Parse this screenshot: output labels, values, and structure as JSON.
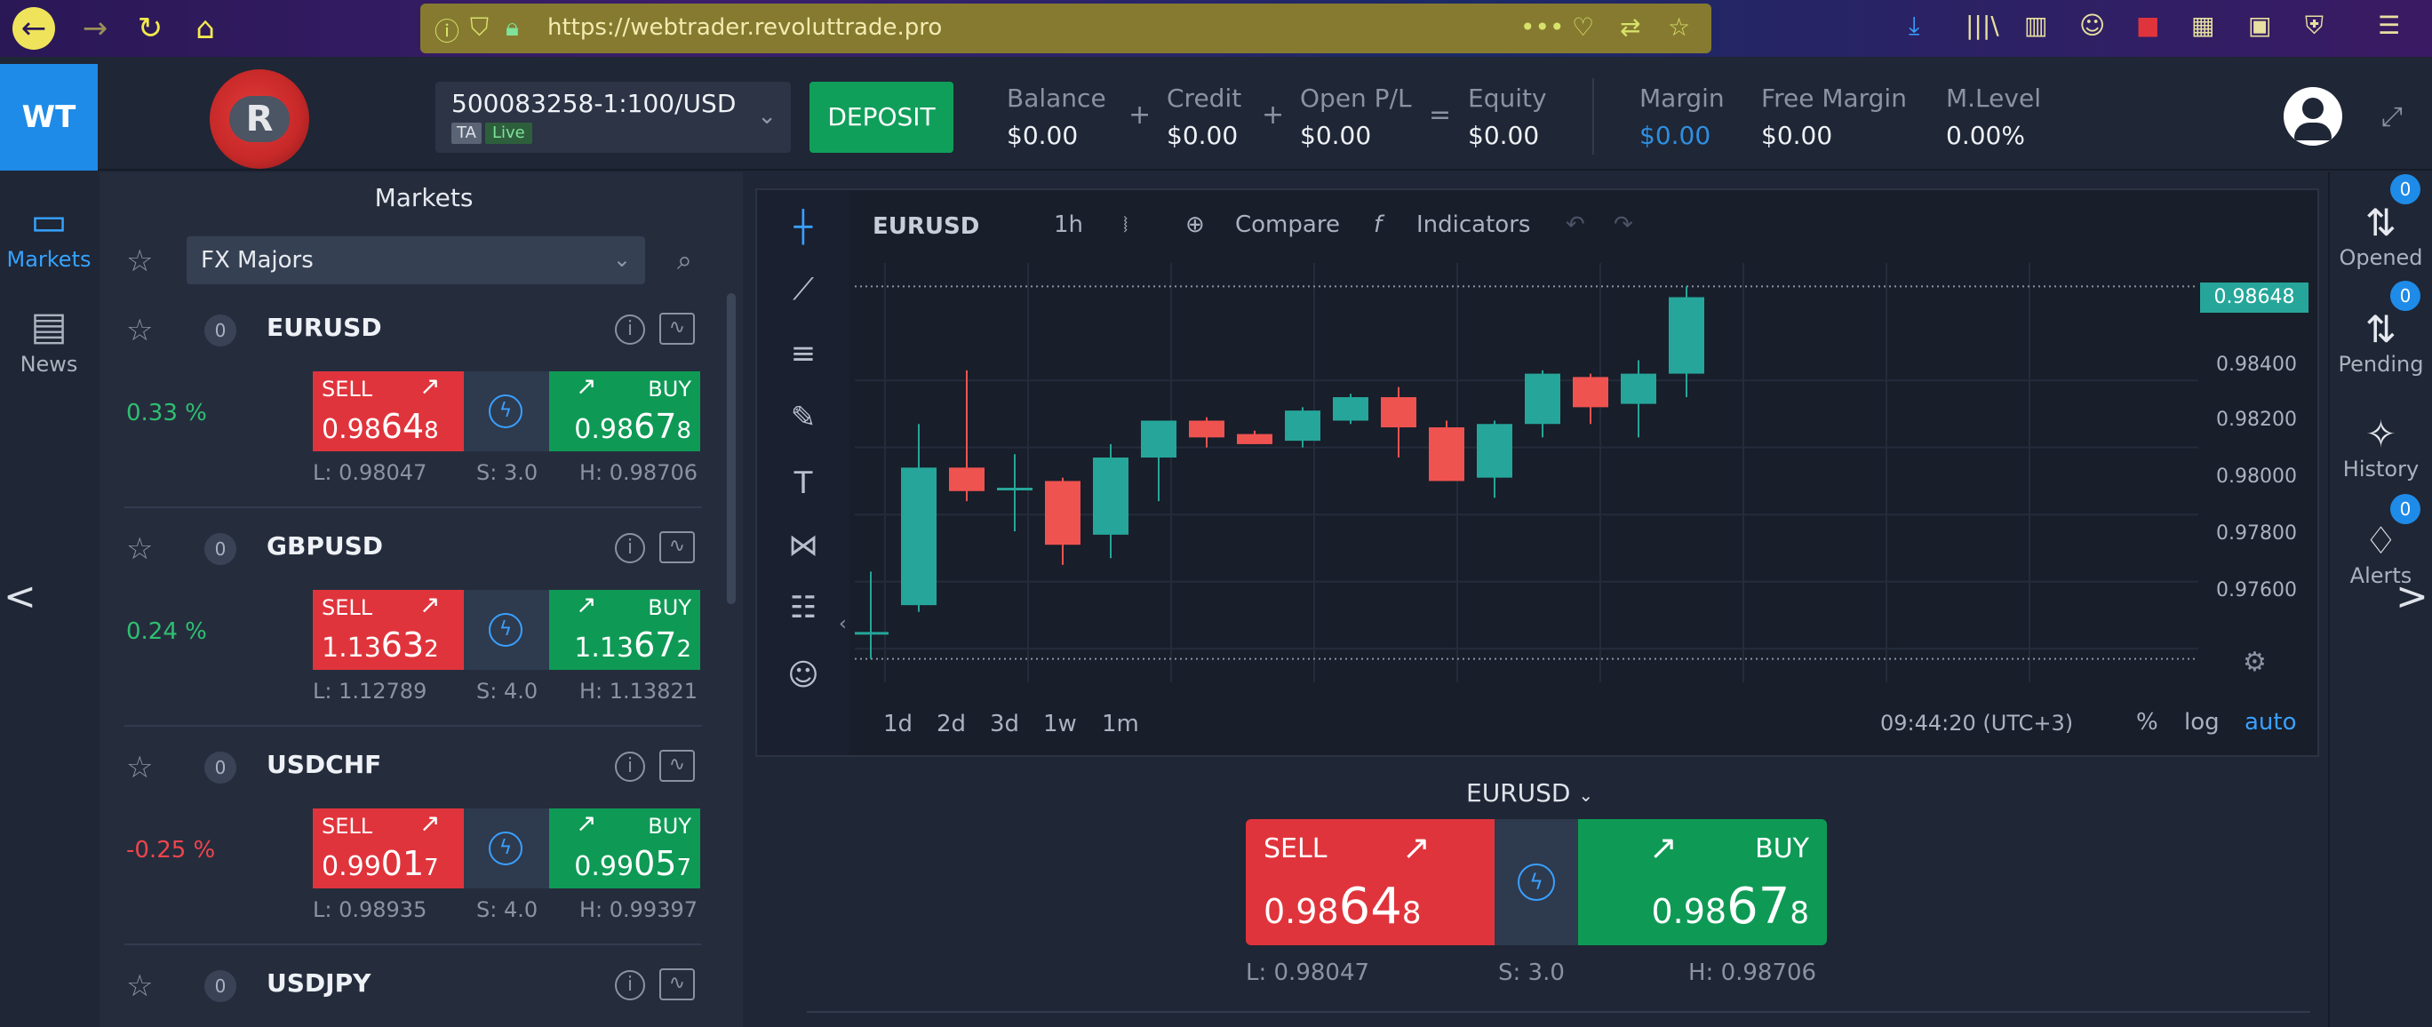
{
  "browser": {
    "url": "https://webtrader.revoluttrade.pro"
  },
  "header": {
    "logo_text": "WT",
    "brand_letter": "R",
    "account_number": "500083258-1:100/USD",
    "account_tag": "TA",
    "account_status": "Live",
    "deposit_label": "DEPOSIT",
    "stats": [
      {
        "label": "Balance",
        "value": "$0.00"
      },
      {
        "label": "Credit",
        "value": "$0.00"
      },
      {
        "label": "Open P/L",
        "value": "$0.00"
      },
      {
        "label": "Equity",
        "value": "$0.00"
      },
      {
        "label": "Margin",
        "value": "$0.00"
      },
      {
        "label": "Free Margin",
        "value": "$0.00"
      },
      {
        "label": "M.Level",
        "value": "0.00%"
      }
    ],
    "operators": [
      "+",
      "+",
      "="
    ],
    "margin_color": "#2f8fe0"
  },
  "sidebar": {
    "markets_label": "Markets",
    "news_label": "News"
  },
  "markets": {
    "title": "Markets",
    "filter": "FX Majors",
    "rows": [
      {
        "symbol": "EURUSD",
        "count": "0",
        "change": "0.33 %",
        "sell_label": "SELL",
        "buy_label": "BUY",
        "sell_price": {
          "pre": "0.98",
          "big": "64",
          "post": "8"
        },
        "buy_price": {
          "pre": "0.98",
          "big": "67",
          "post": "8"
        },
        "low": "L: 0.98047",
        "spread": "S: 3.0",
        "high": "H: 0.98706"
      },
      {
        "symbol": "GBPUSD",
        "count": "0",
        "change": "0.24 %",
        "sell_label": "SELL",
        "buy_label": "BUY",
        "sell_price": {
          "pre": "1.13",
          "big": "63",
          "post": "2"
        },
        "buy_price": {
          "pre": "1.13",
          "big": "67",
          "post": "2"
        },
        "low": "L: 1.12789",
        "spread": "S: 4.0",
        "high": "H: 1.13821"
      },
      {
        "symbol": "USDCHF",
        "count": "0",
        "change": "-0.25 %",
        "sell_label": "SELL",
        "buy_label": "BUY",
        "sell_price": {
          "pre": "0.99",
          "big": "01",
          "post": "7"
        },
        "buy_price": {
          "pre": "0.99",
          "big": "05",
          "post": "7"
        },
        "low": "L: 0.98935",
        "spread": "S: 4.0",
        "high": "H: 0.99397"
      },
      {
        "symbol": "USDJPY",
        "count": "0"
      }
    ],
    "up_color": "#2fbf71",
    "down_color": "#f0444c"
  },
  "chart": {
    "symbol": "EURUSD",
    "interval": "1h",
    "compare_label": "Compare",
    "indicators_label": "Indicators",
    "price_ticks": [
      "0.98400",
      "0.98200",
      "0.98000",
      "0.97800",
      "0.97600"
    ],
    "last_price": "0.98648",
    "timeframes": [
      "1d",
      "2d",
      "3d",
      "1w",
      "1m"
    ],
    "clock": "09:44:20 (UTC+3)",
    "scale_options": [
      "%",
      "log",
      "auto"
    ],
    "up_color": "#26a69a",
    "down_color": "#ef5350"
  },
  "chart_data": {
    "type": "candlestick",
    "ylim": [
      0.975,
      0.9875
    ],
    "candles": [
      {
        "o": 0.9765,
        "h": 0.9783,
        "l": 0.9757,
        "c": 0.9765
      },
      {
        "o": 0.9773,
        "h": 0.9827,
        "l": 0.9771,
        "c": 0.9814
      },
      {
        "o": 0.9814,
        "h": 0.9843,
        "l": 0.9804,
        "c": 0.9807
      },
      {
        "o": 0.9808,
        "h": 0.9818,
        "l": 0.9795,
        "c": 0.9808
      },
      {
        "o": 0.981,
        "h": 0.9811,
        "l": 0.9785,
        "c": 0.9791
      },
      {
        "o": 0.9794,
        "h": 0.9821,
        "l": 0.9787,
        "c": 0.9817
      },
      {
        "o": 0.9817,
        "h": 0.9828,
        "l": 0.9804,
        "c": 0.9828
      },
      {
        "o": 0.9828,
        "h": 0.9829,
        "l": 0.982,
        "c": 0.9823
      },
      {
        "o": 0.9824,
        "h": 0.9825,
        "l": 0.9821,
        "c": 0.9821
      },
      {
        "o": 0.9822,
        "h": 0.9832,
        "l": 0.982,
        "c": 0.9831
      },
      {
        "o": 0.9828,
        "h": 0.9836,
        "l": 0.9827,
        "c": 0.9835
      },
      {
        "o": 0.9835,
        "h": 0.9838,
        "l": 0.9817,
        "c": 0.9826
      },
      {
        "o": 0.9826,
        "h": 0.9828,
        "l": 0.981,
        "c": 0.981
      },
      {
        "o": 0.9811,
        "h": 0.9828,
        "l": 0.9805,
        "c": 0.9827
      },
      {
        "o": 0.9827,
        "h": 0.9843,
        "l": 0.9823,
        "c": 0.9842
      },
      {
        "o": 0.9841,
        "h": 0.9842,
        "l": 0.9827,
        "c": 0.9832
      },
      {
        "o": 0.9833,
        "h": 0.9846,
        "l": 0.9823,
        "c": 0.9842
      },
      {
        "o": 0.9842,
        "h": 0.9868,
        "l": 0.9835,
        "c": 0.98648
      }
    ]
  },
  "trade": {
    "symbol": "EURUSD",
    "sell_label": "SELL",
    "buy_label": "BUY",
    "sell_price": {
      "pre": "0.98",
      "big": "64",
      "post": "8"
    },
    "buy_price": {
      "pre": "0.98",
      "big": "67",
      "post": "8"
    },
    "low": "L: 0.98047",
    "spread": "S: 3.0",
    "high": "H: 0.98706"
  },
  "rightbar": {
    "items": [
      {
        "label": "Opened",
        "badge": "0"
      },
      {
        "label": "Pending",
        "badge": "0"
      },
      {
        "label": "History"
      },
      {
        "label": "Alerts",
        "badge": "0"
      }
    ]
  }
}
